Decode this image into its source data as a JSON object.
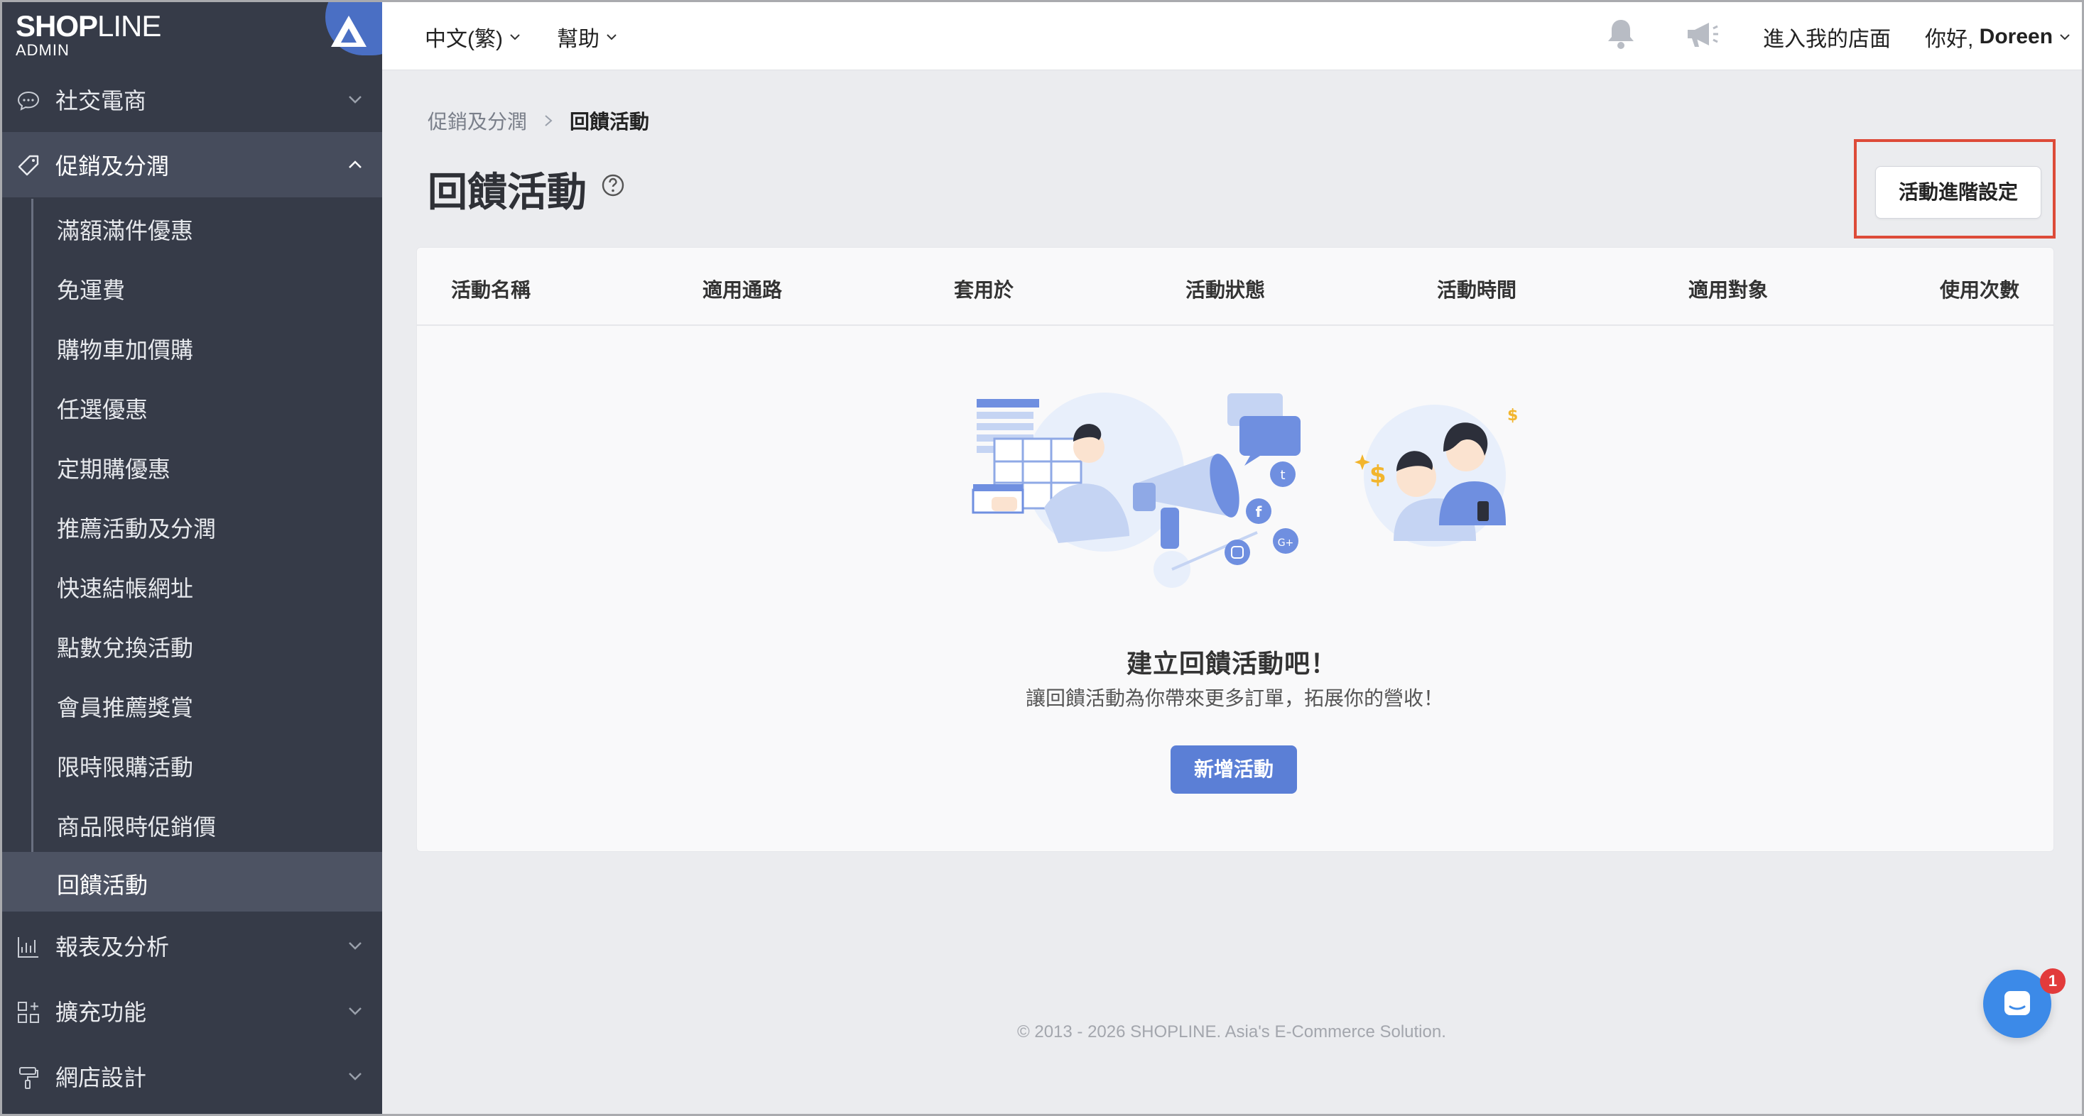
{
  "brand": {
    "name_bold": "SHOP",
    "name_light": "LINE",
    "sub": "ADMIN"
  },
  "topbar": {
    "language": "中文(繁)",
    "help": "幫助",
    "enter_store": "進入我的店面",
    "greeting": "你好, ",
    "username": "Doreen"
  },
  "sidebar": {
    "groups_top": [
      {
        "label": "社交電商",
        "icon": "chat-bubble-icon"
      },
      {
        "label": "促銷及分潤",
        "icon": "tag-icon"
      }
    ],
    "sub_items": [
      {
        "label": "滿額滿件優惠"
      },
      {
        "label": "免運費"
      },
      {
        "label": "購物車加價購"
      },
      {
        "label": "任選優惠"
      },
      {
        "label": "定期購優惠"
      },
      {
        "label": "推薦活動及分潤"
      },
      {
        "label": "快速結帳網址"
      },
      {
        "label": "點數兌換活動"
      },
      {
        "label": "會員推薦獎賞"
      },
      {
        "label": "限時限購活動"
      },
      {
        "label": "商品限時促銷價"
      },
      {
        "label": "回饋活動"
      }
    ],
    "groups_bottom": [
      {
        "label": "報表及分析",
        "icon": "chart-icon"
      },
      {
        "label": "擴充功能",
        "icon": "grid-plus-icon"
      },
      {
        "label": "網店設計",
        "icon": "paint-roller-icon"
      }
    ]
  },
  "breadcrumb": {
    "parent": "促銷及分潤",
    "current": "回饋活動"
  },
  "page": {
    "title": "回饋活動",
    "advanced_button": "活動進階設定"
  },
  "table": {
    "columns": [
      "活動名稱",
      "適用通路",
      "套用於",
      "活動狀態",
      "活動時間",
      "適用對象",
      "使用次數"
    ]
  },
  "empty_state": {
    "title": "建立回饋活動吧！",
    "subtitle": "讓回饋活動為你帶來更多訂單，拓展你的營收！",
    "button": "新增活動"
  },
  "footer": {
    "text": "© 2013 - 2026 SHOPLINE. Asia's E-Commerce Solution."
  },
  "chat": {
    "unread": "1"
  },
  "colors": {
    "sidebar": "#363b48",
    "primary": "#5b7fd6",
    "highlight": "#dd4b39",
    "chat": "#3c8ae8"
  }
}
